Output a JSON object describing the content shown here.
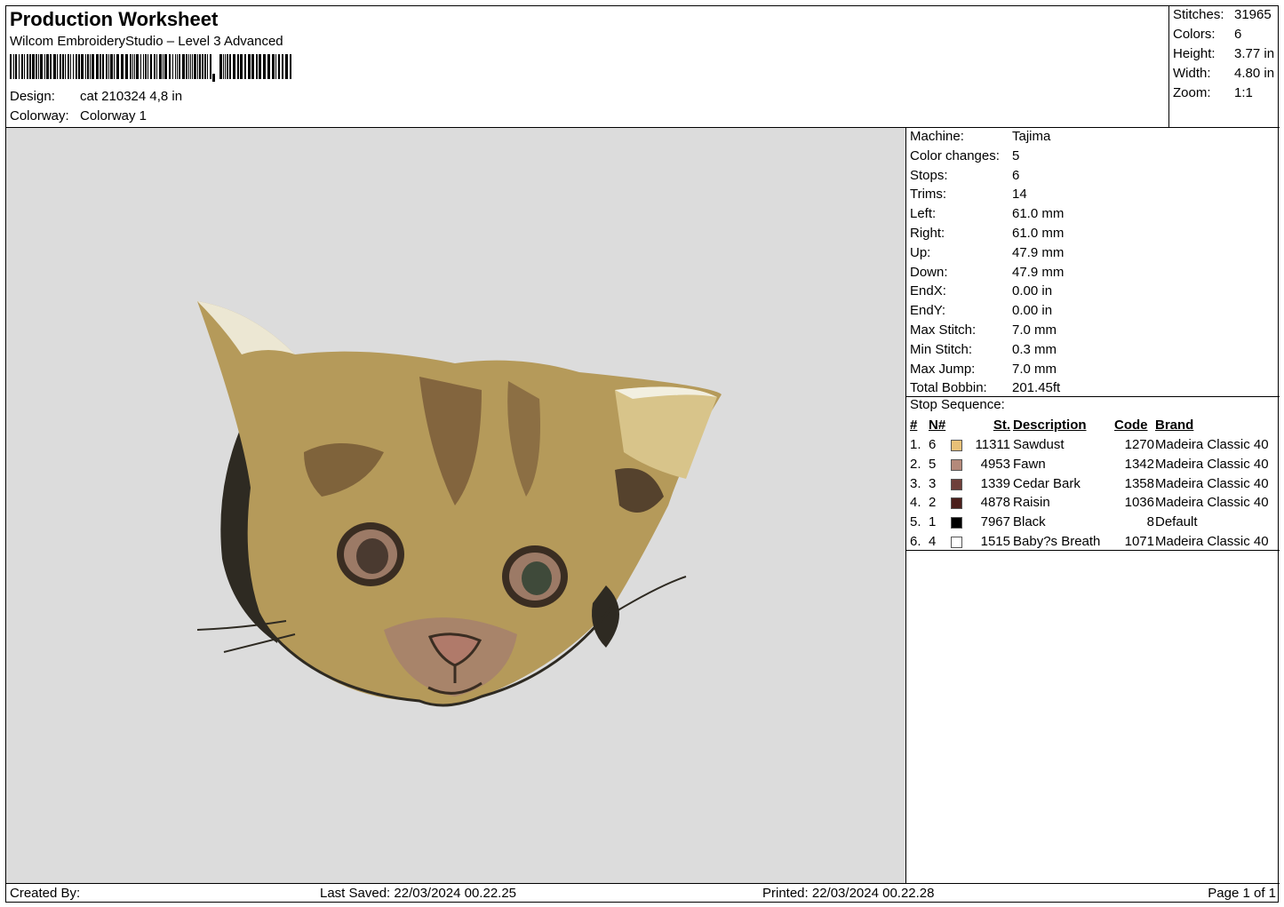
{
  "header": {
    "title": "Production Worksheet",
    "software": "Wilcom EmbroideryStudio – Level 3 Advanced",
    "design_label": "Design:",
    "design_value": "cat 210324 4,8 in",
    "colorway_label": "Colorway:",
    "colorway_value": "Colorway 1"
  },
  "summary": [
    {
      "label": "Stitches:",
      "value": "31965"
    },
    {
      "label": "Colors:",
      "value": "6"
    },
    {
      "label": "Height:",
      "value": "3.77 in"
    },
    {
      "label": "Width:",
      "value": "4.80 in"
    },
    {
      "label": "Zoom:",
      "value": "1:1"
    }
  ],
  "details": [
    {
      "label": "Machine:",
      "value": "Tajima"
    },
    {
      "label": "Color changes:",
      "value": "5"
    },
    {
      "label": "Stops:",
      "value": "6"
    },
    {
      "label": "Trims:",
      "value": "14"
    },
    {
      "label": "Left:",
      "value": "61.0 mm"
    },
    {
      "label": "Right:",
      "value": "61.0 mm"
    },
    {
      "label": "Up:",
      "value": "47.9 mm"
    },
    {
      "label": "Down:",
      "value": "47.9 mm"
    },
    {
      "label": "EndX:",
      "value": "0.00 in"
    },
    {
      "label": "EndY:",
      "value": "0.00 in"
    },
    {
      "label": "Max Stitch:",
      "value": "7.0 mm"
    },
    {
      "label": "Min Stitch:",
      "value": "0.3 mm"
    },
    {
      "label": "Max Jump:",
      "value": "7.0 mm"
    },
    {
      "label": "Total Bobbin:",
      "value": "201.45ft"
    }
  ],
  "stop_sequence": {
    "title": "Stop Sequence:",
    "headers": {
      "num": "#",
      "n": "N#",
      "st": "St.",
      "description": "Description",
      "code": "Code",
      "brand": "Brand"
    },
    "rows": [
      {
        "num": "1.",
        "n": "6",
        "color": "#e8c078",
        "st": "11311",
        "description": "Sawdust",
        "code": "1270",
        "brand": "Madeira Classic 40"
      },
      {
        "num": "2.",
        "n": "5",
        "color": "#b4897a",
        "st": "4953",
        "description": "Fawn",
        "code": "1342",
        "brand": "Madeira Classic 40"
      },
      {
        "num": "3.",
        "n": "3",
        "color": "#6e3f3a",
        "st": "1339",
        "description": "Cedar Bark",
        "code": "1358",
        "brand": "Madeira Classic 40"
      },
      {
        "num": "4.",
        "n": "2",
        "color": "#4a1f1c",
        "st": "4878",
        "description": "Raisin",
        "code": "1036",
        "brand": "Madeira Classic 40"
      },
      {
        "num": "5.",
        "n": "1",
        "color": "#000000",
        "st": "7967",
        "description": "Black",
        "code": "8",
        "brand": "Default"
      },
      {
        "num": "6.",
        "n": "4",
        "color": "#ffffff",
        "st": "1515",
        "description": "Baby?s Breath",
        "code": "1071",
        "brand": "Madeira Classic 40"
      }
    ]
  },
  "footer": {
    "created_by": "Created By:",
    "last_saved": "Last Saved: 22/03/2024 00.22.25",
    "printed": "Printed: 22/03/2024 00.22.28",
    "page": "Page 1 of 1"
  },
  "colors": {
    "preview_bg": "#dcdcdc",
    "cat_base": "#b59a5a",
    "cat_dark": "#3a2d22",
    "cat_stripe": "#7a5c3a",
    "cat_nose": "#b07a6a",
    "ear_white": "#f2efe0"
  }
}
